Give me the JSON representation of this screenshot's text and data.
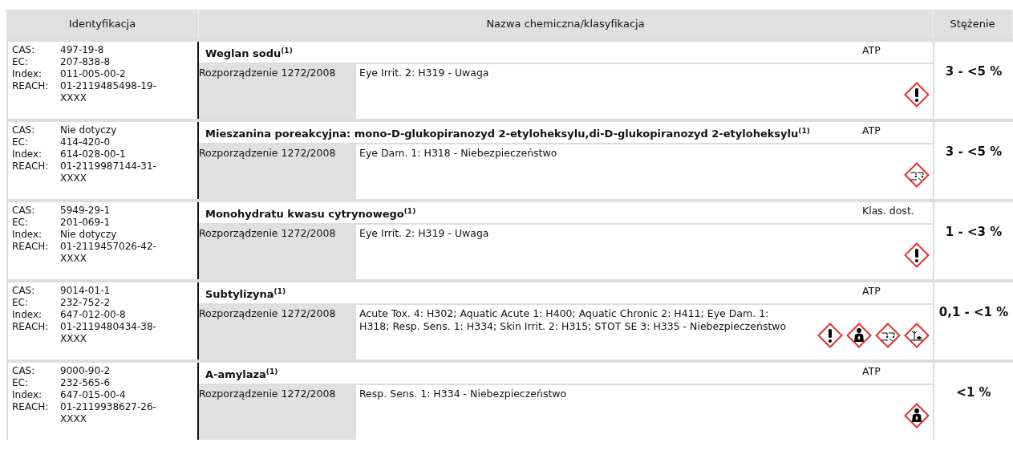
{
  "table": {
    "columns": [
      "Identyfikacja",
      "Nazwa chemiczna/klasyfikacja",
      "Stężenie"
    ],
    "rows": [
      {
        "ids": [
          {
            "label": "CAS:",
            "value": "497-19-8"
          },
          {
            "label": "EC:",
            "value": "207-838-8"
          },
          {
            "label": "Index:",
            "value": "011-005-00-2"
          },
          {
            "label": "REACH:",
            "value": "01-2119485498-19-XXXX"
          }
        ],
        "name": "Weglan sodu$^{(1)}$",
        "source": "ATP",
        "regulation": "Rozporządzenie 1272/2008",
        "classification": "Eye Irrit. 2: H319 - Uwaga",
        "pictograms": [
          {
            "kind": "exclamation"
          }
        ],
        "concentration": "3 - <5 %"
      },
      {
        "ids": [
          {
            "label": "CAS:",
            "value": "Nie dotyczy"
          },
          {
            "label": "EC:",
            "value": "414-420-0"
          },
          {
            "label": "Index:",
            "value": "614-028-00-1"
          },
          {
            "label": "REACH:",
            "value": "01-2119987144-31-XXXX"
          }
        ],
        "name": "Mieszanina poreakcyjna: mono-D-glukopiranozyd 2-etyloheksylu,di-D-glukopiranozyd 2-etyloheksylu$^{(1)}$",
        "source": "ATP",
        "regulation": "Rozporządzenie 1272/2008",
        "classification": "Eye Dam. 1: H318 - Niebezpieczeństwo",
        "pictograms": [
          {
            "kind": "corrosion"
          }
        ],
        "concentration": "3 - <5 %"
      },
      {
        "ids": [
          {
            "label": "CAS:",
            "value": "5949-29-1"
          },
          {
            "label": "EC:",
            "value": "201-069-1"
          },
          {
            "label": "Index:",
            "value": "Nie dotyczy"
          },
          {
            "label": "REACH:",
            "value": "01-2119457026-42-XXXX"
          }
        ],
        "name": "Monohydratu kwasu cytrynowego$^{(1)}$",
        "source": "Klas. dost.",
        "regulation": "Rozporządzenie 1272/2008",
        "classification": "Eye Irrit. 2: H319 - Uwaga",
        "pictograms": [
          {
            "kind": "exclamation"
          }
        ],
        "concentration": "1 - <3 %"
      },
      {
        "ids": [
          {
            "label": "CAS:",
            "value": "9014-01-1"
          },
          {
            "label": "EC:",
            "value": "232-752-2"
          },
          {
            "label": "Index:",
            "value": "647-012-00-8"
          },
          {
            "label": "REACH:",
            "value": "01-2119480434-38-XXXX"
          }
        ],
        "name": "Subtylizyna$^{(1)}$",
        "source": "ATP",
        "regulation": "Rozporządzenie 1272/2008",
        "classification": "Acute Tox. 4: H302; Aquatic Acute 1: H400; Aquatic Chronic 2: H411; Eye Dam. 1: H318; Resp. Sens. 1: H334; Skin Irrit. 2: H315; STOT SE 3: H335 - Niebezpieczeństwo",
        "pictograms": [
          {
            "kind": "exclamation"
          },
          {
            "kind": "health"
          },
          {
            "kind": "corrosion"
          },
          {
            "kind": "environment"
          }
        ],
        "concentration": "0,1 - <1 %"
      },
      {
        "ids": [
          {
            "label": "CAS:",
            "value": "9000-90-2"
          },
          {
            "label": "EC:",
            "value": "232-565-6"
          },
          {
            "label": "Index:",
            "value": "647-015-00-4"
          },
          {
            "label": "REACH:",
            "value": "01-2119938627-26-XXXX"
          }
        ],
        "name": "A-amylaza$^{(1)}$",
        "source": "ATP",
        "regulation": "Rozporządzenie 1272/2008",
        "classification": "Resp. Sens. 1: H334 - Niebezpieczeństwo",
        "pictograms": [
          {
            "kind": "health"
          }
        ],
        "concentration": "<1 %"
      }
    ]
  }
}
